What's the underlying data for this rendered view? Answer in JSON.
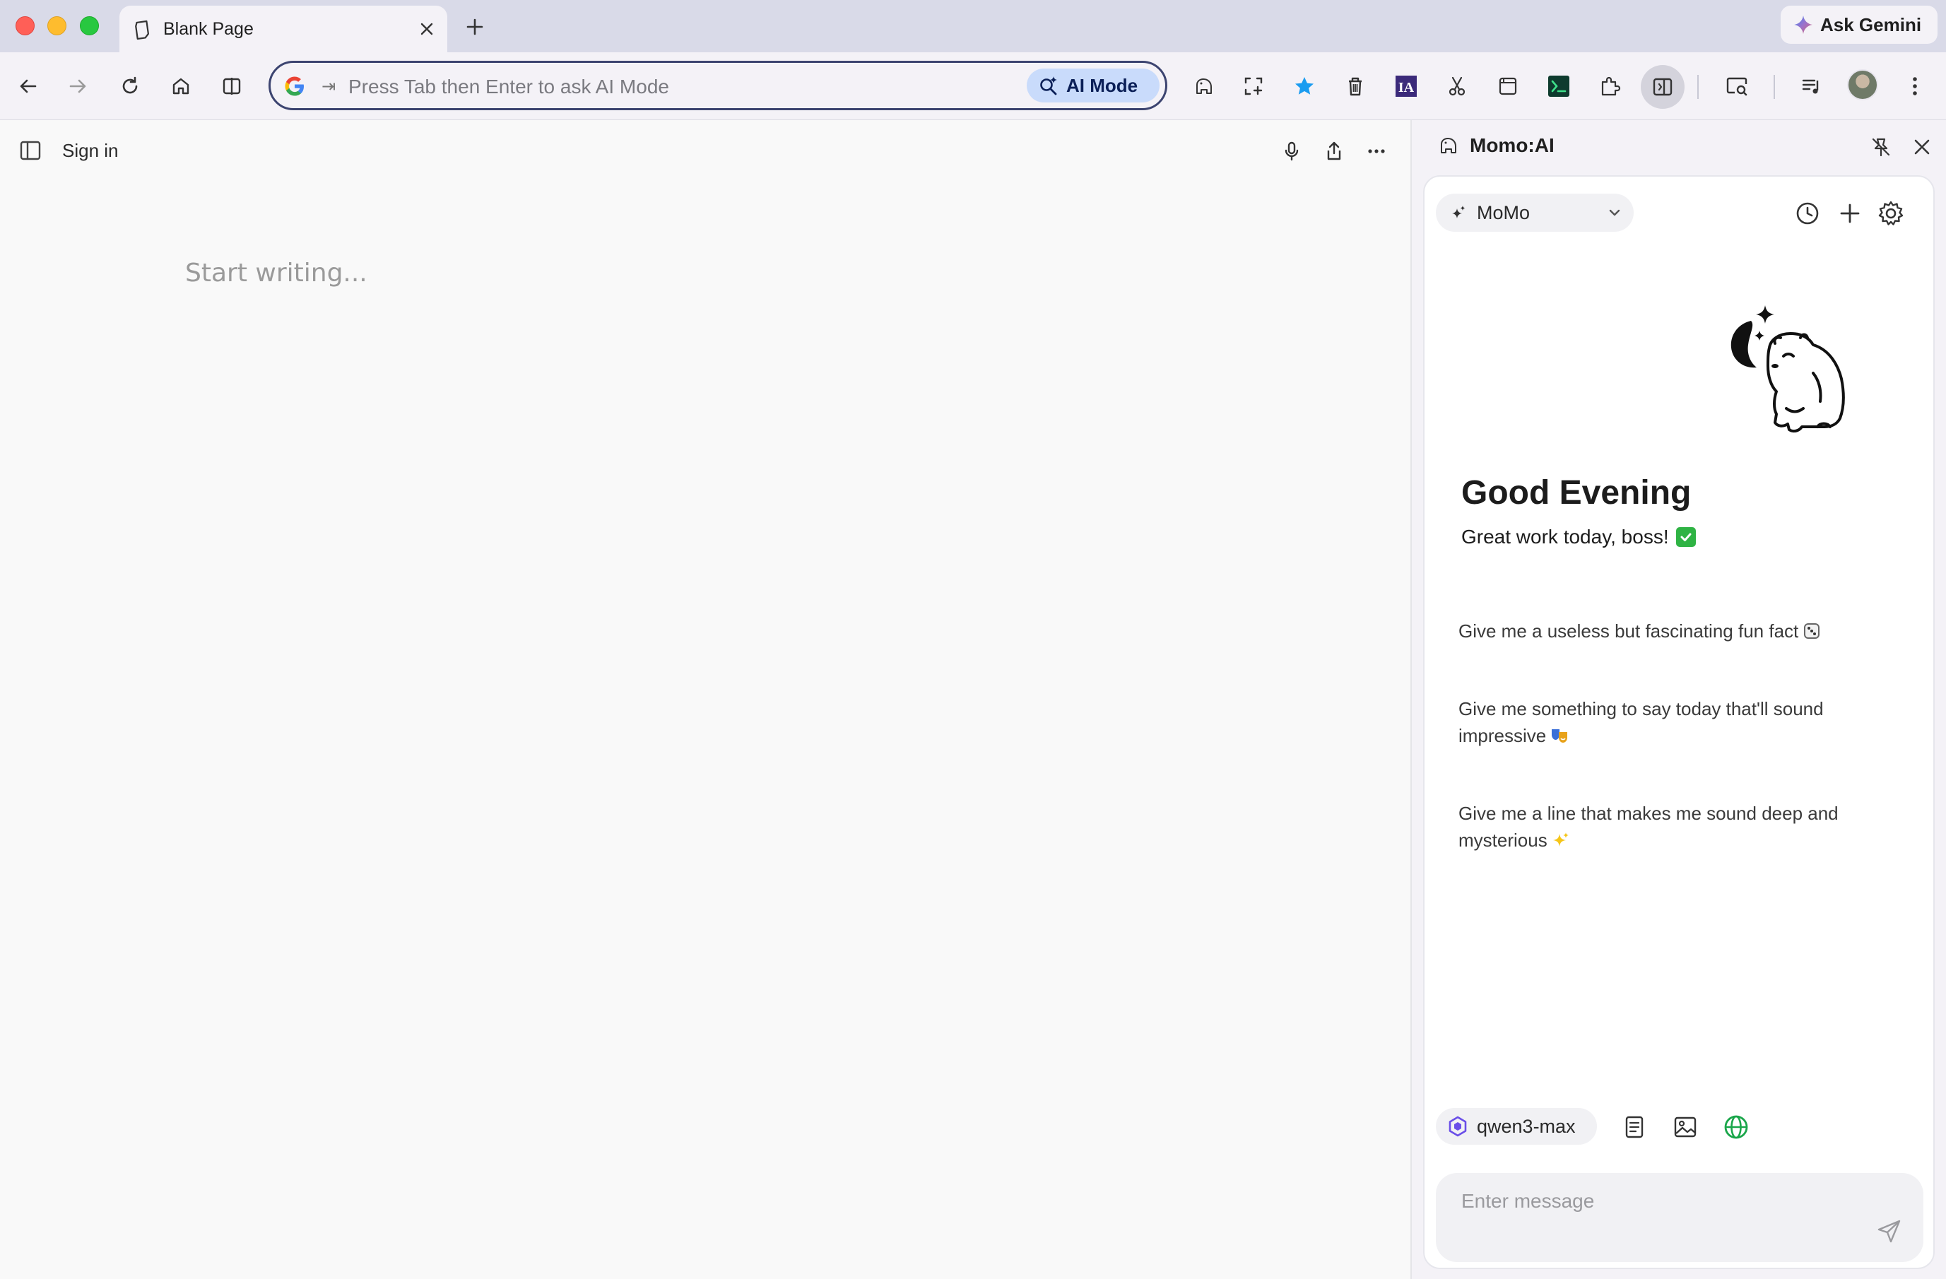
{
  "browser": {
    "tab": {
      "title": "Blank Page"
    },
    "gemini": {
      "label": "Ask Gemini"
    },
    "omnibox": {
      "tab_hint": "⇥",
      "placeholder": "Press Tab then Enter to ask AI Mode",
      "ai_mode_label": "AI Mode"
    }
  },
  "editor": {
    "signin_label": "Sign in",
    "placeholder": "Start writing..."
  },
  "panel": {
    "title": "Momo:AI",
    "agent": "MoMo",
    "greeting": "Good Evening",
    "subgreeting": "Great work today, boss!",
    "prompts": [
      {
        "text": "Give me a useless but fascinating fun fact",
        "emoji": "dice-emoji"
      },
      {
        "text": "Give me something to say today that'll sound impressive",
        "emoji": "theater-masks-emoji"
      },
      {
        "text": "Give me a line that makes me sound deep and mysterious",
        "emoji": "sparkles-emoji"
      }
    ],
    "model": "qwen3-max",
    "message_placeholder": "Enter message"
  },
  "colors": {
    "accent_ai_mode": "#c9dbfb",
    "star_blue": "#1a9cf0",
    "web_search_green": "#1aa64a",
    "model_purple": "#6a4ee8",
    "check_green": "#2fb344"
  }
}
